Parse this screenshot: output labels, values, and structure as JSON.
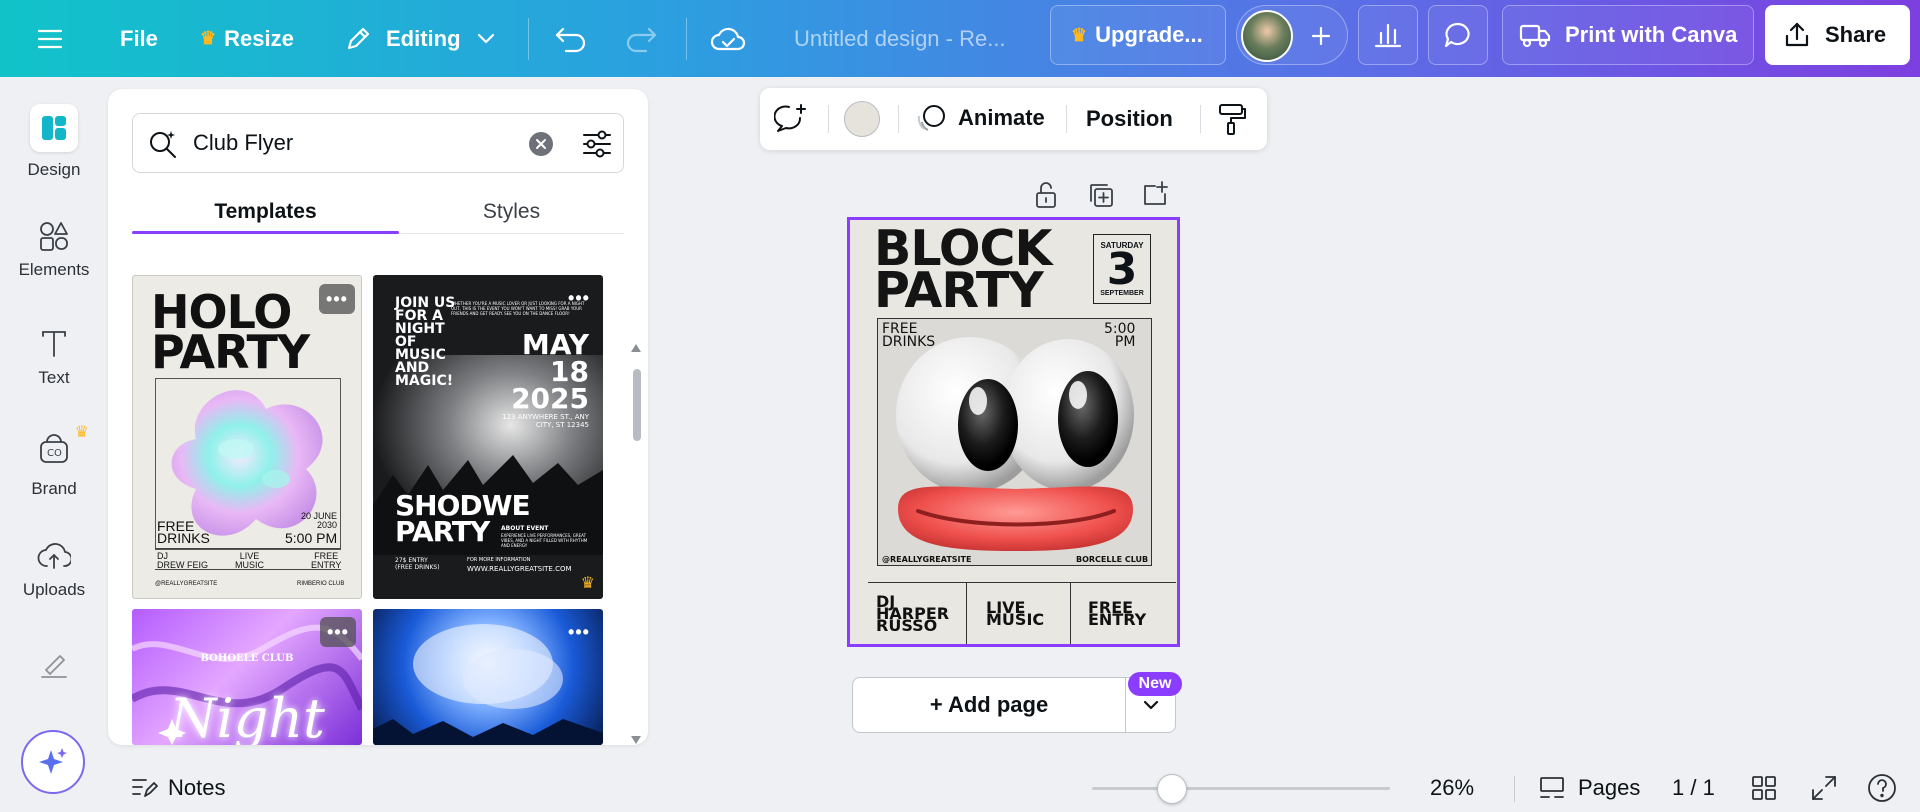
{
  "topbar": {
    "file_label": "File",
    "resize_label": "Resize",
    "editing_label": "Editing",
    "doc_title": "Untitled design - Re...",
    "upgrade_label": "Upgrade...",
    "print_label": "Print with Canva",
    "share_label": "Share"
  },
  "rail": [
    {
      "label": "Design"
    },
    {
      "label": "Elements"
    },
    {
      "label": "Text"
    },
    {
      "label": "Brand"
    },
    {
      "label": "Uploads"
    }
  ],
  "panel": {
    "search_value": "Club Flyer",
    "tabs": [
      "Templates",
      "Styles"
    ],
    "templates": [
      {
        "title": "HOLO\nPARTY",
        "free_drinks": "FREE\nDRINKS",
        "date": "20 JUNE\n2030",
        "time": "5:00 PM",
        "dj": "DJ\nDREW FEIG",
        "live": "LIVE\nMUSIC",
        "entry": "FREE\nENTRY",
        "handle": "@REALLYGREATSITE",
        "venue": "RIMBERIO CLUB"
      },
      {
        "join": "JOIN US\nFOR A\nNIGHT\nOF\nMUSIC\nAND\nMAGIC!",
        "intro": "WHETHER YOU'RE A MUSIC LOVER OR JUST LOOKING FOR A NIGHT OUT, THIS IS THE EVENT YOU WON'T WANT TO MISS! GRAB YOUR FRIENDS AND GET READY. SEE YOU ON THE DANCE FLOOR!",
        "date": "MAY\n18\n2025",
        "address": "123 ANYWHERE ST., ANY CITY, ST 12345",
        "title": "SHODWE\nPARTY",
        "about_head": "ABOUT EVENT",
        "about": "EXPERIENCE LIVE PERFORMANCES, GREAT VIBES, AND A NIGHT FILLED WITH RHYTHM AND ENERGY",
        "entry": "27$ ENTRY\n(FREE DRINKS)",
        "info_head": "FOR MORE INFORMATION",
        "site": "WWW.REALLYGREATSITE.COM"
      },
      {
        "club": "BOHOELE CLUB",
        "word": "Night"
      },
      {}
    ]
  },
  "context_bar": {
    "animate_label": "Animate",
    "position_label": "Position",
    "fill_color": "#e6e3dc"
  },
  "design": {
    "title": "BLOCK\nPARTY",
    "day": "SATURDAY",
    "date_num": "3",
    "month": "SEPTEMBER",
    "free_drinks": "FREE\nDRINKS",
    "time": "5:00\nPM",
    "handle": "@REALLYGREATSITE",
    "venue": "BORCELLE CLUB",
    "col1": "DJ\nHARPER\nRUSSO",
    "col2": "LIVE\nMUSIC",
    "col3": "FREE\nENTRY"
  },
  "add_page_label": "+ Add page",
  "new_badge": "New",
  "bottom": {
    "notes_label": "Notes",
    "zoom": "26%",
    "pages_label": "Pages",
    "page_count": "1 / 1"
  },
  "colors": {
    "accent": "#8b3dff",
    "crown": "#ffb81f"
  }
}
